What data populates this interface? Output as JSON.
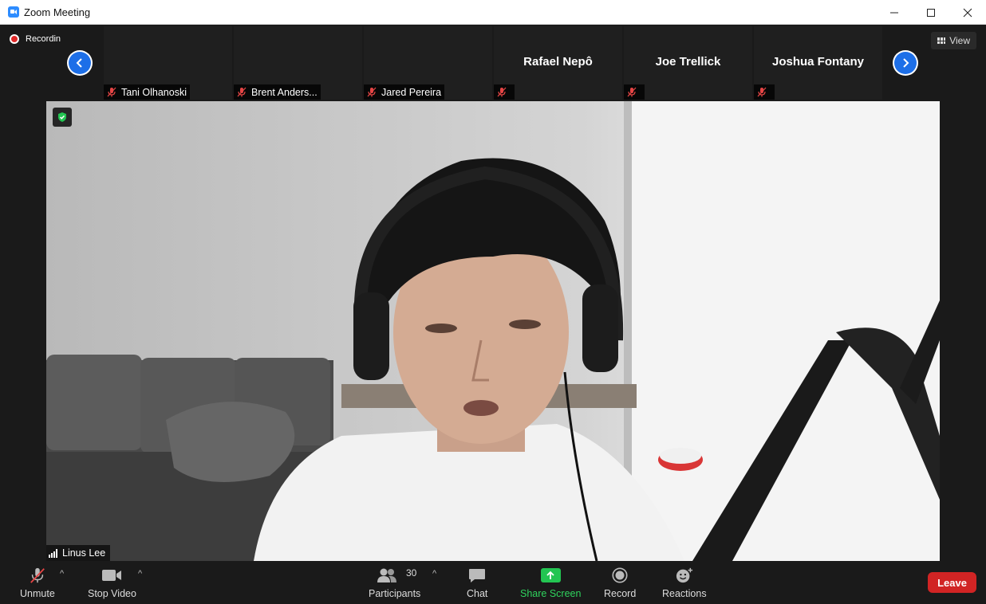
{
  "window": {
    "title": "Zoom Meeting",
    "minimize_icon": "minimize-icon",
    "maximize_icon": "maximize-icon",
    "close_icon": "close-icon"
  },
  "top_strip": {
    "recording_label": "Recordin",
    "view_label": "View",
    "participants": [
      {
        "label": "Tani Olhanoski",
        "big_name": "",
        "muted": true
      },
      {
        "label": "Brent Anders...",
        "big_name": "",
        "muted": true
      },
      {
        "label": "Jared Pereira",
        "big_name": "",
        "muted": true
      },
      {
        "label": "",
        "big_name": "Rafael Nepô",
        "muted": true
      },
      {
        "label": "",
        "big_name": "Joe Trellick",
        "muted": true
      },
      {
        "label": "",
        "big_name": "Joshua Fontany",
        "muted": true
      }
    ]
  },
  "main_video": {
    "speaker_name": "Linus Lee",
    "encryption_icon": "shield-check-icon"
  },
  "toolbar": {
    "unmute_label": "Unmute",
    "stop_video_label": "Stop Video",
    "participants_label": "Participants",
    "participants_count": "30",
    "chat_label": "Chat",
    "share_screen_label": "Share Screen",
    "record_label": "Record",
    "reactions_label": "Reactions",
    "leave_label": "Leave",
    "caret": "^"
  },
  "colors": {
    "accent_blue": "#1d6fe8",
    "share_green": "#23c552",
    "leave_red": "#d12424",
    "rec_red": "#e02828"
  }
}
